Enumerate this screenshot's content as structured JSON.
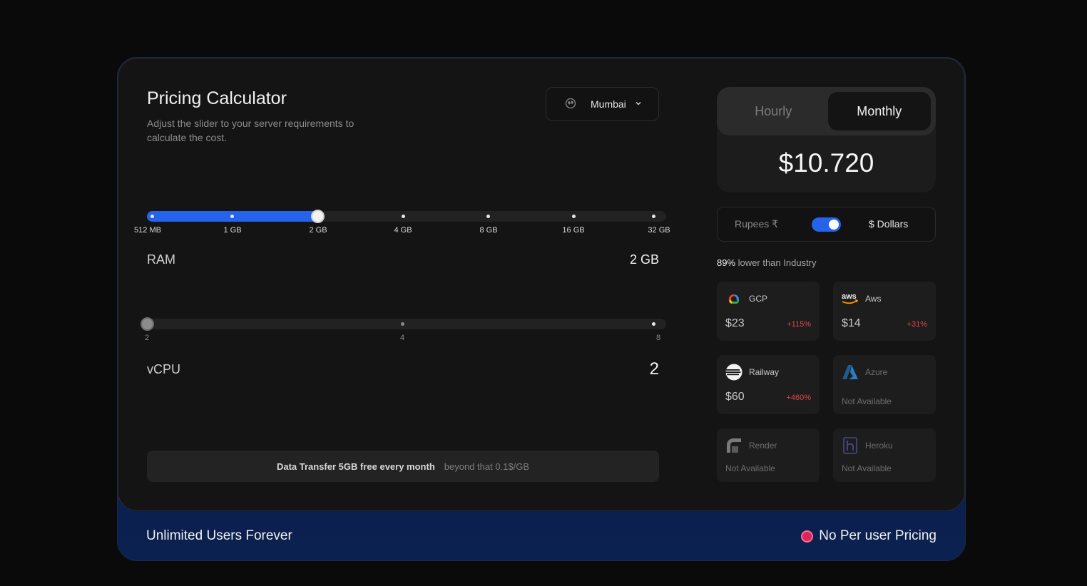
{
  "header": {
    "title": "Pricing Calculator",
    "subtitle": "Adjust the slider to your server requirements to calculate the cost."
  },
  "region": {
    "icon": "globe-icon",
    "value": "Mumbai"
  },
  "ram": {
    "label": "RAM",
    "value": "2 GB",
    "ticks": [
      "512 MB",
      "1 GB",
      "2 GB",
      "4 GB",
      "8 GB",
      "16 GB",
      "32 GB"
    ],
    "selected_index": 2
  },
  "vcpu": {
    "label": "vCPU",
    "value": "2",
    "ticks": [
      "2",
      "4",
      "8"
    ],
    "selected_index": 0
  },
  "transfer": {
    "main": "Data Transfer 5GB free every month",
    "extra": "beyond that 0.1$/GB"
  },
  "billing": {
    "options": [
      "Hourly",
      "Monthly"
    ],
    "active": "Monthly",
    "price": "$10.720"
  },
  "currency": {
    "left": "Rupees ₹",
    "right": "$ Dollars",
    "dollars_selected": true
  },
  "comparison": {
    "percent": "89%",
    "text": "lower than Industry"
  },
  "providers": [
    {
      "name": "GCP",
      "price": "$23",
      "diff": "+115%",
      "icon": "gcp-logo-icon"
    },
    {
      "name": "Aws",
      "price": "$14",
      "diff": "+31%",
      "icon": "aws-logo-icon"
    },
    {
      "name": "Railway",
      "price": "$60",
      "diff": "+460%",
      "icon": "railway-logo-icon"
    },
    {
      "name": "Azure",
      "status": "Not Available",
      "icon": "azure-logo-icon"
    },
    {
      "name": "Render",
      "status": "Not Available",
      "icon": "render-logo-icon"
    },
    {
      "name": "Heroku",
      "status": "Not Available",
      "icon": "heroku-logo-icon"
    }
  ],
  "footer": {
    "left": "Unlimited Users Forever",
    "right": "No Per user Pricing"
  },
  "colors": {
    "accent": "#2563eb",
    "negative": "#e0464a",
    "badge": "#d8265a"
  }
}
